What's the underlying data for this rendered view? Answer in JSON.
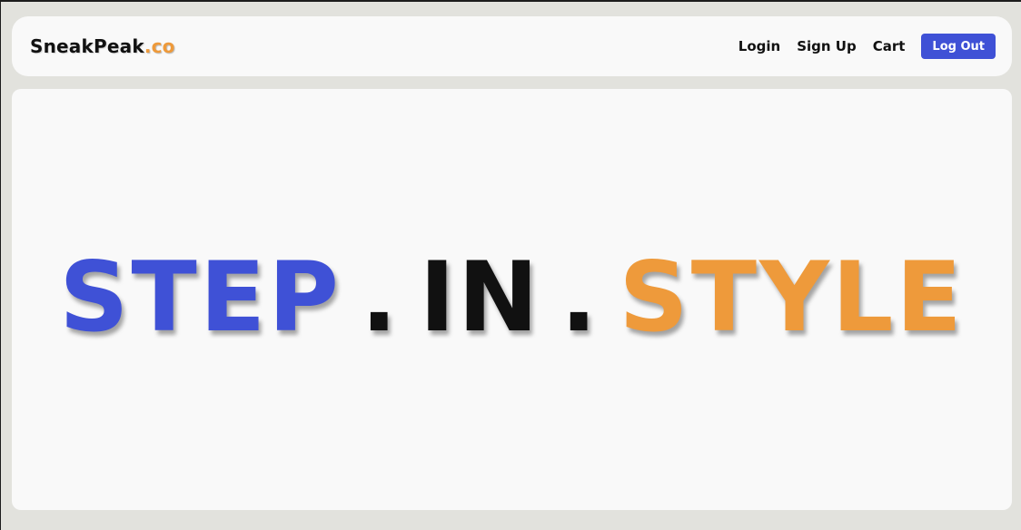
{
  "colors": {
    "accent_blue": "#3f51d6",
    "accent_orange": "#ee9a3b",
    "text_dark": "#111111"
  },
  "navbar": {
    "brand_name": "SneakPeak",
    "brand_suffix": ".co",
    "links": [
      {
        "label": "Login"
      },
      {
        "label": "Sign Up"
      },
      {
        "label": "Cart"
      }
    ],
    "logout_label": "Log Out"
  },
  "hero": {
    "word1": "STEP",
    "dot1": ".",
    "word2": "IN",
    "dot2": ".",
    "word3": "STYLE"
  }
}
